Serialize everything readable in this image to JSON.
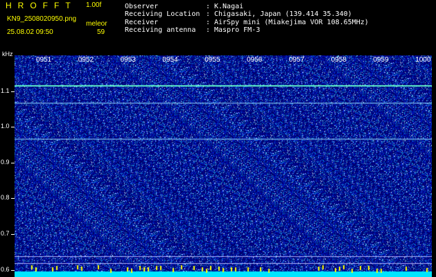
{
  "header": {
    "title": "HROFFT",
    "version": "1.00f",
    "filename": "KN9_2508020950.png",
    "datetime": "25.08.02 09:50",
    "mode_label": "meleor",
    "count": "59"
  },
  "metadata": [
    {
      "label": "Observer",
      "value": "K.Nagai"
    },
    {
      "label": "Receiving Location",
      "value": "Chigasaki, Japan (139.414 35.340)"
    },
    {
      "label": "Receiver",
      "value": "AirSpy mini (Miakejima VOR 108.65MHz)"
    },
    {
      "label": "Receiving antenna",
      "value": "Maspro FM-3"
    }
  ],
  "axis": {
    "y_unit": "kHz",
    "x_ticks": [
      "0951",
      "0952",
      "0953",
      "0954",
      "0955",
      "0956",
      "0957",
      "0958",
      "0959",
      "1000"
    ],
    "y_ticks": [
      "1.1",
      "1.0",
      "0.9",
      "0.8",
      "0.7",
      "0.6"
    ]
  },
  "colors": {
    "header_text": "#ffff00",
    "waterfall_bg": "#00006e",
    "carrier_line": "#66ffcc",
    "baseline_band": "#00e5ff"
  },
  "chart_data": {
    "type": "heatmap",
    "x_ticks": [
      "0951",
      "0952",
      "0953",
      "0954",
      "0955",
      "0956",
      "0957",
      "0958",
      "0959",
      "1000"
    ],
    "ylabel": "kHz",
    "ylim": [
      0.58,
      1.2
    ],
    "carrier_lines_khz": [
      1.115,
      1.067,
      0.965
    ]
  }
}
